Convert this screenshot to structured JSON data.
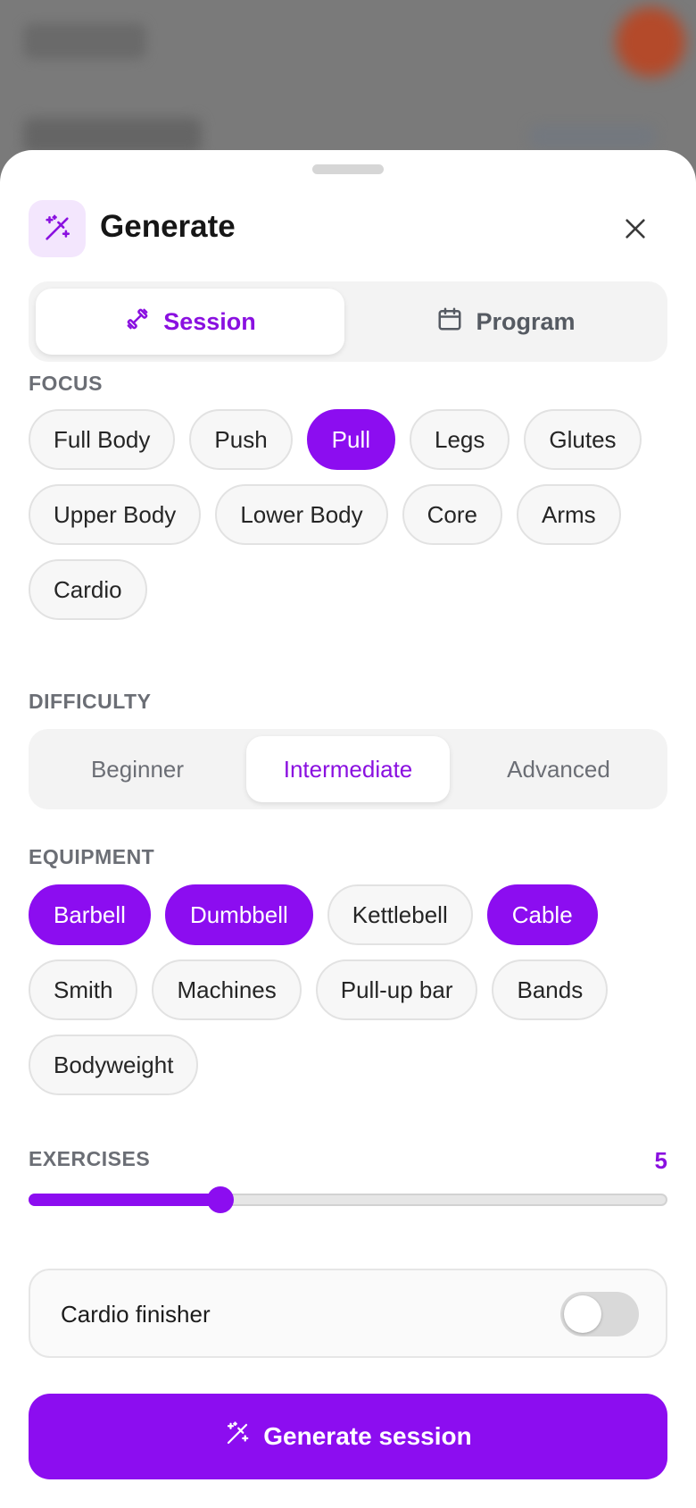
{
  "header": {
    "title": "Generate",
    "icon": "magic-wand-icon",
    "close_icon": "close-icon"
  },
  "mode_tabs": [
    {
      "label": "Session",
      "icon": "dumbbell-icon",
      "active": true
    },
    {
      "label": "Program",
      "icon": "calendar-icon",
      "active": false
    }
  ],
  "focus": {
    "label": "FOCUS",
    "options": [
      "Full Body",
      "Push",
      "Pull",
      "Legs",
      "Glutes",
      "Upper Body",
      "Lower Body",
      "Core",
      "Arms",
      "Cardio"
    ],
    "selected": [
      "Pull"
    ]
  },
  "difficulty": {
    "label": "DIFFICULTY",
    "options": [
      "Beginner",
      "Intermediate",
      "Advanced"
    ],
    "selected": "Intermediate"
  },
  "equipment": {
    "label": "EQUIPMENT",
    "options": [
      "Barbell",
      "Dumbbell",
      "Kettlebell",
      "Cable",
      "Smith",
      "Machines",
      "Pull-up bar",
      "Bands",
      "Bodyweight"
    ],
    "selected": [
      "Barbell",
      "Dumbbell",
      "Cable"
    ]
  },
  "exercises": {
    "label": "EXERCISES",
    "value": "5",
    "fraction": 0.3
  },
  "cardio_finisher": {
    "label": "Cardio finisher",
    "enabled": false
  },
  "generate_button": {
    "label": "Generate session",
    "icon": "magic-wand-icon"
  },
  "colors": {
    "accent": "#8c0df0",
    "accent_light": "#f3e6fd",
    "chip_bg": "#f7f7f7",
    "muted_text": "#6b6e75"
  }
}
